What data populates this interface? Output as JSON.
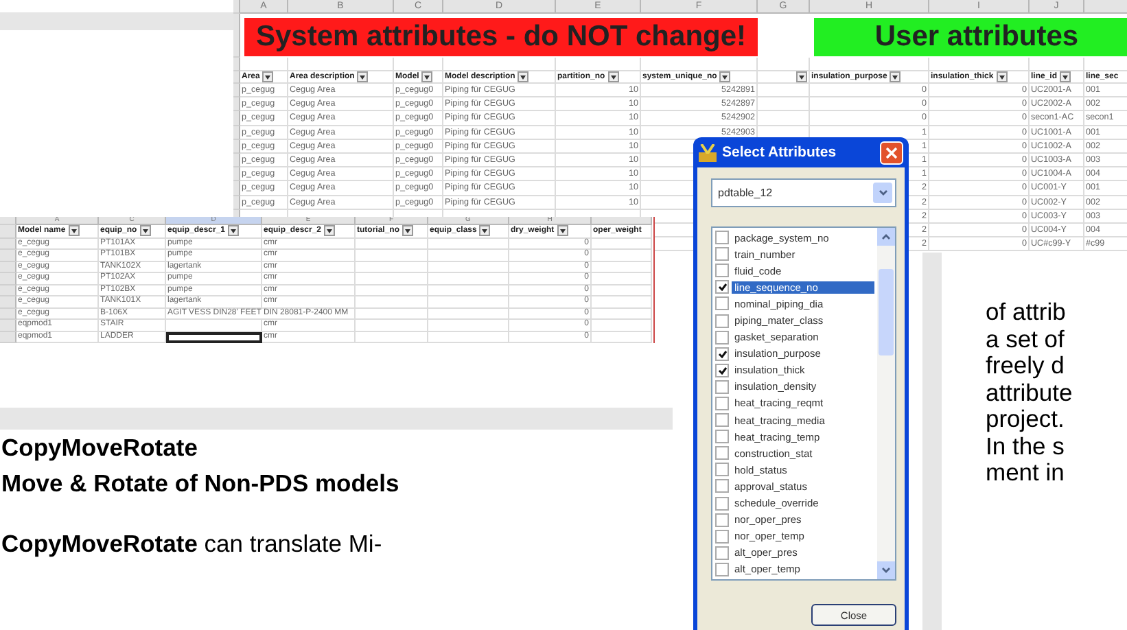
{
  "top_sheet": {
    "banners": [
      {
        "kind": "system",
        "text": "System attributes - do NOT change!"
      },
      {
        "kind": "user",
        "text": "User attributes"
      }
    ],
    "columns": [
      {
        "letter": "A",
        "label": "Area"
      },
      {
        "letter": "B",
        "label": "Area description"
      },
      {
        "letter": "C",
        "label": "Model"
      },
      {
        "letter": "D",
        "label": "Model description"
      },
      {
        "letter": "E",
        "label": "partition_no"
      },
      {
        "letter": "F",
        "label": "system_unique_no"
      },
      {
        "letter": "G"
      },
      {
        "letter": "H",
        "label": "insulation_purpose"
      },
      {
        "letter": "I",
        "label": "insulation_thick"
      },
      {
        "letter": "J",
        "label": "line_id"
      },
      {
        "label": "line_sec"
      }
    ],
    "rows": [
      [
        "p_cegug",
        "Cegug Area",
        "p_cegug0",
        "Piping für CEGUG",
        "10",
        "5242891",
        null,
        "0",
        "0",
        "UC2001-A",
        "001"
      ],
      [
        "p_cegug",
        "Cegug Area",
        "p_cegug0",
        "Piping für CEGUG",
        "10",
        "5242897",
        null,
        "0",
        "0",
        "UC2002-A",
        "002"
      ],
      [
        "p_cegug",
        "Cegug Area",
        "p_cegug0",
        "Piping für CEGUG",
        "10",
        "5242902",
        null,
        "0",
        "0",
        "secon1-AC",
        "secon1"
      ],
      [
        "p_cegug",
        "Cegug Area",
        "p_cegug0",
        "Piping für CEGUG",
        "10",
        "5242903",
        null,
        "1",
        "0",
        "UC1001-A",
        "001"
      ],
      [
        "p_cegug",
        "Cegug Area",
        "p_cegug0",
        "Piping für CEGUG",
        "10",
        null,
        null,
        "1",
        "0",
        "UC1002-A",
        "002"
      ],
      [
        "p_cegug",
        "Cegug Area",
        "p_cegug0",
        "Piping für CEGUG",
        "10",
        null,
        null,
        "1",
        "0",
        "UC1003-A",
        "003"
      ],
      [
        "p_cegug",
        "Cegug Area",
        "p_cegug0",
        "Piping für CEGUG",
        "10",
        null,
        null,
        "1",
        "0",
        "UC1004-A",
        "004"
      ],
      [
        "p_cegug",
        "Cegug Area",
        "p_cegug0",
        "Piping für CEGUG",
        "10",
        null,
        null,
        "2",
        "0",
        "UC001-Y",
        "001"
      ],
      [
        "p_cegug",
        "Cegug Area",
        "p_cegug0",
        "Piping für CEGUG",
        "10",
        null,
        null,
        "2",
        "0",
        "UC002-Y",
        "002"
      ],
      [
        null,
        null,
        null,
        null,
        null,
        null,
        null,
        "2",
        "0",
        "UC003-Y",
        "003"
      ],
      [
        null,
        null,
        null,
        null,
        null,
        null,
        null,
        "2",
        "0",
        "UC004-Y",
        "004"
      ],
      [
        null,
        null,
        null,
        null,
        null,
        null,
        null,
        "2",
        "0",
        "UC#c99-Y",
        "#c99"
      ]
    ]
  },
  "equipment_sheet": {
    "columns": [
      {
        "letter": "A",
        "label": "Model name",
        "selected": false
      },
      {
        "letter": "C",
        "label": "equip_no",
        "selected": false
      },
      {
        "letter": "D",
        "label": "equip_descr_1",
        "selected": true
      },
      {
        "letter": "E",
        "label": "equip_descr_2",
        "selected": false
      },
      {
        "letter": "F",
        "label": "tutorial_no",
        "selected": false
      },
      {
        "letter": "G",
        "label": "equip_class",
        "selected": false
      },
      {
        "letter": "H",
        "label": "dry_weight",
        "selected": false
      },
      {
        "label": "oper_weight",
        "selected": false
      }
    ],
    "rows": [
      {
        "selected": false,
        "cells": [
          "e_cegug",
          "PT101AX",
          "pumpe",
          "cmr",
          null,
          null,
          "0",
          null
        ]
      },
      {
        "selected": false,
        "cells": [
          "e_cegug",
          "PT101BX",
          "pumpe",
          "cmr",
          null,
          null,
          "0",
          null
        ]
      },
      {
        "selected": false,
        "cells": [
          "e_cegug",
          "TANK102X",
          "lagertank",
          "cmr",
          null,
          null,
          "0",
          null
        ]
      },
      {
        "selected": false,
        "cells": [
          "e_cegug",
          "PT102AX",
          "pumpe",
          "cmr",
          null,
          null,
          "0",
          null
        ]
      },
      {
        "selected": false,
        "cells": [
          "e_cegug",
          "PT102BX",
          "pumpe",
          "cmr",
          null,
          null,
          "0",
          null
        ]
      },
      {
        "selected": false,
        "cells": [
          "e_cegug",
          "TANK101X",
          "lagertank",
          "cmr",
          null,
          null,
          "0",
          null
        ]
      },
      {
        "selected": false,
        "cells": [
          "e_cegug",
          "B-106X",
          "AGIT VESS DIN28' FEET DIN 28081-P-2400 MM",
          null,
          null,
          null,
          "0",
          null
        ]
      },
      {
        "selected": false,
        "cells": [
          "eqpmod1",
          "STAIR",
          null,
          "cmr",
          null,
          null,
          "0",
          null
        ]
      },
      {
        "selected": true,
        "cells": [
          "eqpmod1",
          "LADDER",
          null,
          "cmr",
          null,
          null,
          "0",
          null
        ]
      }
    ]
  },
  "dialog": {
    "title": "Select Attributes",
    "table": "pdtable_12",
    "button": "Close",
    "items": [
      {
        "label": "package_system_no",
        "checked": false,
        "selected": false
      },
      {
        "label": "train_number",
        "checked": false,
        "selected": false
      },
      {
        "label": "fluid_code",
        "checked": false,
        "selected": false
      },
      {
        "label": "line_sequence_no",
        "checked": true,
        "selected": true
      },
      {
        "label": "nominal_piping_dia",
        "checked": false,
        "selected": false
      },
      {
        "label": "piping_mater_class",
        "checked": false,
        "selected": false
      },
      {
        "label": "gasket_separation",
        "checked": false,
        "selected": false
      },
      {
        "label": "insulation_purpose",
        "checked": true,
        "selected": false
      },
      {
        "label": "insulation_thick",
        "checked": true,
        "selected": false
      },
      {
        "label": "insulation_density",
        "checked": false,
        "selected": false
      },
      {
        "label": "heat_tracing_reqmt",
        "checked": false,
        "selected": false
      },
      {
        "label": "heat_tracing_media",
        "checked": false,
        "selected": false
      },
      {
        "label": "heat_tracing_temp",
        "checked": false,
        "selected": false
      },
      {
        "label": "construction_stat",
        "checked": false,
        "selected": false
      },
      {
        "label": "hold_status",
        "checked": false,
        "selected": false
      },
      {
        "label": "approval_status",
        "checked": false,
        "selected": false
      },
      {
        "label": "schedule_override",
        "checked": false,
        "selected": false
      },
      {
        "label": "nor_oper_pres",
        "checked": false,
        "selected": false
      },
      {
        "label": "nor_oper_temp",
        "checked": false,
        "selected": false
      },
      {
        "label": "alt_oper_pres",
        "checked": false,
        "selected": false
      },
      {
        "label": "alt_oper_temp",
        "checked": false,
        "selected": false
      }
    ]
  },
  "heading": [
    "CopyMoveRotate",
    "Move & Rotate of Non-PDS models"
  ],
  "paragraph": "**CopyMoveRotate** can translate Mi-",
  "side_text": [
    "of attrib",
    "a set of",
    "freely d",
    "attribute",
    "project.",
    "In the s",
    "ment in"
  ]
}
